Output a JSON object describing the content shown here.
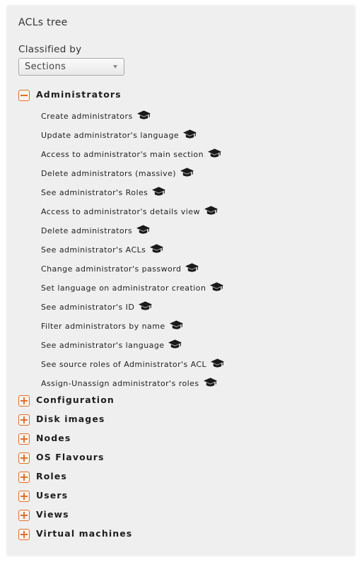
{
  "panel": {
    "title": "ACLs tree",
    "classified_by_label": "Classified by",
    "classified_by_value": "Sections"
  },
  "colors": {
    "panel_background": "#efefef",
    "toggle_accent": "#e0702c",
    "text": "#222222"
  },
  "icons": {
    "expanded": "minus-square-icon",
    "collapsed": "plus-square-icon",
    "acl": "graduation-cap-icon",
    "dropdown": "triangle-down-icon"
  },
  "sections": [
    {
      "label": "Administrators",
      "expanded": true,
      "acls": [
        "Create administrators",
        "Update administrator's language",
        "Access to administrator's main section",
        "Delete administrators (massive)",
        "See administrator's Roles",
        "Access to administrator's details view",
        "Delete administrators",
        "See administrator's ACLs",
        "Change administrator's password",
        "Set language on administrator creation",
        "See administrator's ID",
        "Filter administrators by name",
        "See administrator's language",
        "See source roles of Administrator's ACL",
        "Assign-Unassign administrator's roles"
      ]
    },
    {
      "label": "Configuration",
      "expanded": false
    },
    {
      "label": "Disk images",
      "expanded": false
    },
    {
      "label": "Nodes",
      "expanded": false
    },
    {
      "label": "OS Flavours",
      "expanded": false
    },
    {
      "label": "Roles",
      "expanded": false
    },
    {
      "label": "Users",
      "expanded": false
    },
    {
      "label": "Views",
      "expanded": false
    },
    {
      "label": "Virtual machines",
      "expanded": false
    }
  ]
}
